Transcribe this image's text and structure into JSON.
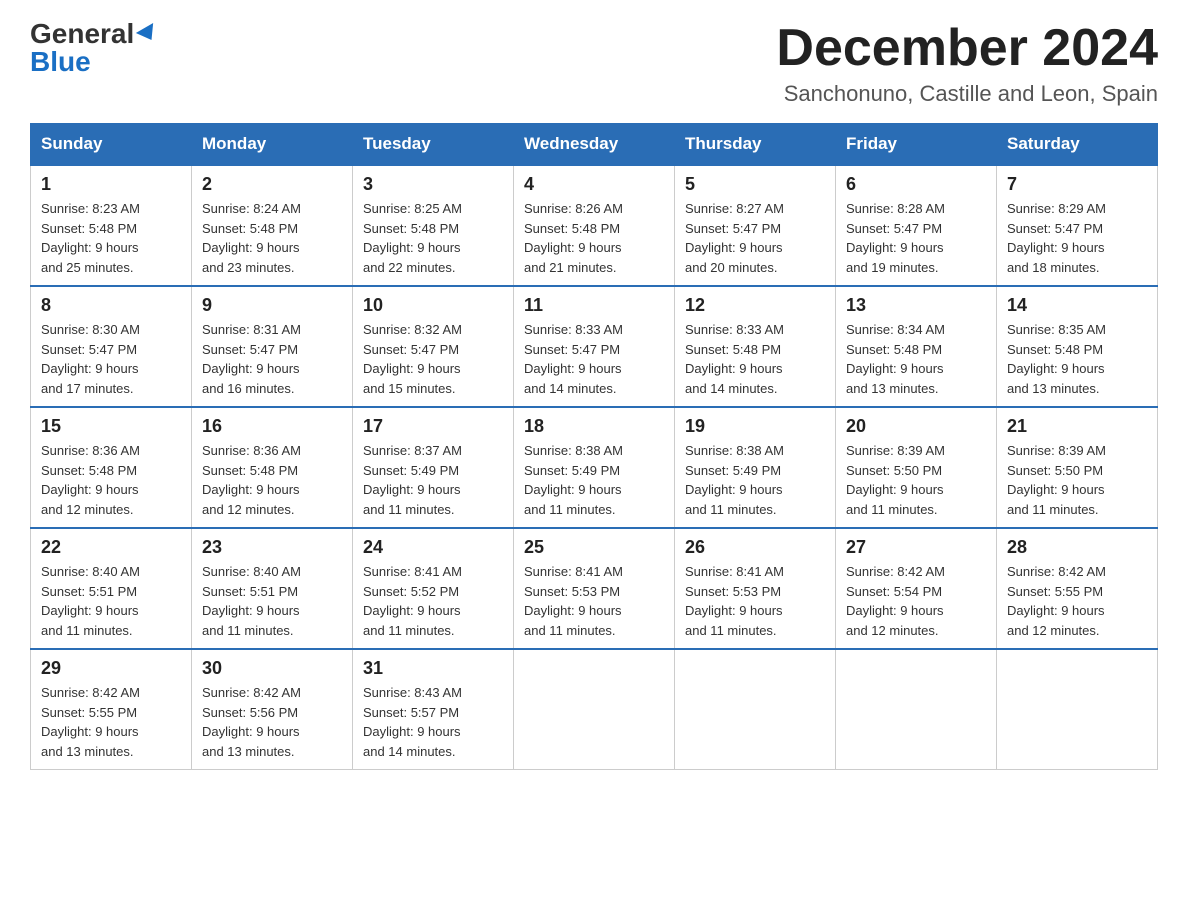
{
  "logo": {
    "general": "General",
    "blue": "Blue"
  },
  "title": {
    "month": "December 2024",
    "location": "Sanchonuno, Castille and Leon, Spain"
  },
  "days_of_week": [
    "Sunday",
    "Monday",
    "Tuesday",
    "Wednesday",
    "Thursday",
    "Friday",
    "Saturday"
  ],
  "weeks": [
    [
      {
        "day": "1",
        "sunrise": "8:23 AM",
        "sunset": "5:48 PM",
        "daylight": "9 hours and 25 minutes."
      },
      {
        "day": "2",
        "sunrise": "8:24 AM",
        "sunset": "5:48 PM",
        "daylight": "9 hours and 23 minutes."
      },
      {
        "day": "3",
        "sunrise": "8:25 AM",
        "sunset": "5:48 PM",
        "daylight": "9 hours and 22 minutes."
      },
      {
        "day": "4",
        "sunrise": "8:26 AM",
        "sunset": "5:48 PM",
        "daylight": "9 hours and 21 minutes."
      },
      {
        "day": "5",
        "sunrise": "8:27 AM",
        "sunset": "5:47 PM",
        "daylight": "9 hours and 20 minutes."
      },
      {
        "day": "6",
        "sunrise": "8:28 AM",
        "sunset": "5:47 PM",
        "daylight": "9 hours and 19 minutes."
      },
      {
        "day": "7",
        "sunrise": "8:29 AM",
        "sunset": "5:47 PM",
        "daylight": "9 hours and 18 minutes."
      }
    ],
    [
      {
        "day": "8",
        "sunrise": "8:30 AM",
        "sunset": "5:47 PM",
        "daylight": "9 hours and 17 minutes."
      },
      {
        "day": "9",
        "sunrise": "8:31 AM",
        "sunset": "5:47 PM",
        "daylight": "9 hours and 16 minutes."
      },
      {
        "day": "10",
        "sunrise": "8:32 AM",
        "sunset": "5:47 PM",
        "daylight": "9 hours and 15 minutes."
      },
      {
        "day": "11",
        "sunrise": "8:33 AM",
        "sunset": "5:47 PM",
        "daylight": "9 hours and 14 minutes."
      },
      {
        "day": "12",
        "sunrise": "8:33 AM",
        "sunset": "5:48 PM",
        "daylight": "9 hours and 14 minutes."
      },
      {
        "day": "13",
        "sunrise": "8:34 AM",
        "sunset": "5:48 PM",
        "daylight": "9 hours and 13 minutes."
      },
      {
        "day": "14",
        "sunrise": "8:35 AM",
        "sunset": "5:48 PM",
        "daylight": "9 hours and 13 minutes."
      }
    ],
    [
      {
        "day": "15",
        "sunrise": "8:36 AM",
        "sunset": "5:48 PM",
        "daylight": "9 hours and 12 minutes."
      },
      {
        "day": "16",
        "sunrise": "8:36 AM",
        "sunset": "5:48 PM",
        "daylight": "9 hours and 12 minutes."
      },
      {
        "day": "17",
        "sunrise": "8:37 AM",
        "sunset": "5:49 PM",
        "daylight": "9 hours and 11 minutes."
      },
      {
        "day": "18",
        "sunrise": "8:38 AM",
        "sunset": "5:49 PM",
        "daylight": "9 hours and 11 minutes."
      },
      {
        "day": "19",
        "sunrise": "8:38 AM",
        "sunset": "5:49 PM",
        "daylight": "9 hours and 11 minutes."
      },
      {
        "day": "20",
        "sunrise": "8:39 AM",
        "sunset": "5:50 PM",
        "daylight": "9 hours and 11 minutes."
      },
      {
        "day": "21",
        "sunrise": "8:39 AM",
        "sunset": "5:50 PM",
        "daylight": "9 hours and 11 minutes."
      }
    ],
    [
      {
        "day": "22",
        "sunrise": "8:40 AM",
        "sunset": "5:51 PM",
        "daylight": "9 hours and 11 minutes."
      },
      {
        "day": "23",
        "sunrise": "8:40 AM",
        "sunset": "5:51 PM",
        "daylight": "9 hours and 11 minutes."
      },
      {
        "day": "24",
        "sunrise": "8:41 AM",
        "sunset": "5:52 PM",
        "daylight": "9 hours and 11 minutes."
      },
      {
        "day": "25",
        "sunrise": "8:41 AM",
        "sunset": "5:53 PM",
        "daylight": "9 hours and 11 minutes."
      },
      {
        "day": "26",
        "sunrise": "8:41 AM",
        "sunset": "5:53 PM",
        "daylight": "9 hours and 11 minutes."
      },
      {
        "day": "27",
        "sunrise": "8:42 AM",
        "sunset": "5:54 PM",
        "daylight": "9 hours and 12 minutes."
      },
      {
        "day": "28",
        "sunrise": "8:42 AM",
        "sunset": "5:55 PM",
        "daylight": "9 hours and 12 minutes."
      }
    ],
    [
      {
        "day": "29",
        "sunrise": "8:42 AM",
        "sunset": "5:55 PM",
        "daylight": "9 hours and 13 minutes."
      },
      {
        "day": "30",
        "sunrise": "8:42 AM",
        "sunset": "5:56 PM",
        "daylight": "9 hours and 13 minutes."
      },
      {
        "day": "31",
        "sunrise": "8:43 AM",
        "sunset": "5:57 PM",
        "daylight": "9 hours and 14 minutes."
      },
      null,
      null,
      null,
      null
    ]
  ],
  "labels": {
    "sunrise": "Sunrise:",
    "sunset": "Sunset:",
    "daylight": "Daylight:"
  }
}
